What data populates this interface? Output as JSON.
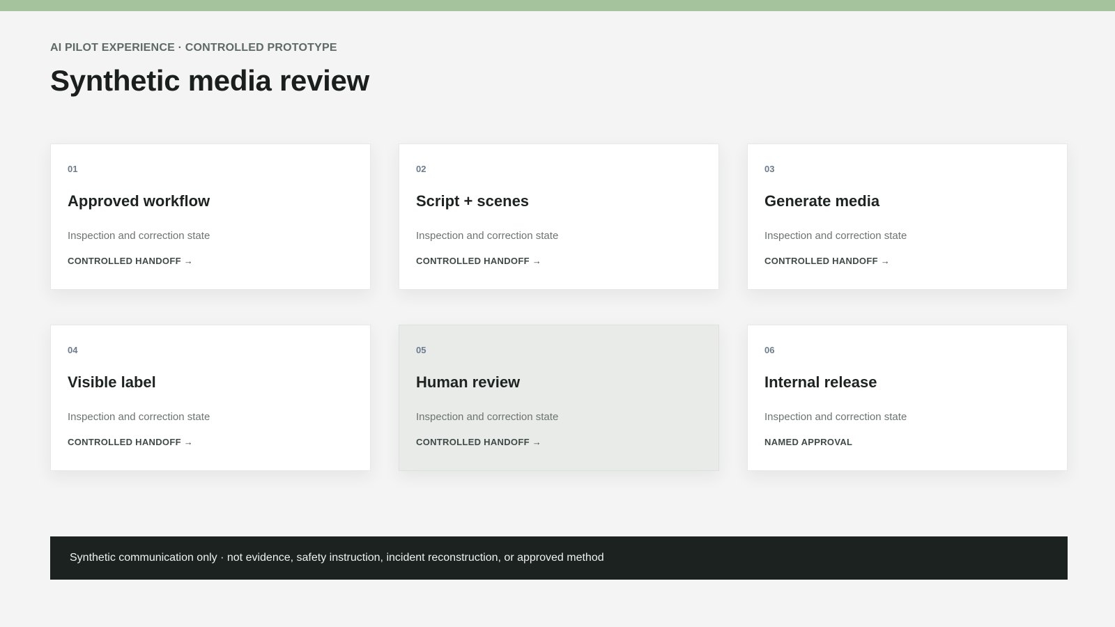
{
  "header": {
    "eyebrow": "AI PILOT EXPERIENCE · CONTROLLED PROTOTYPE",
    "title": "Synthetic media review"
  },
  "cards": [
    {
      "number": "01",
      "title": "Approved workflow",
      "description": "Inspection and correction state",
      "action": "CONTROLLED HANDOFF →"
    },
    {
      "number": "02",
      "title": "Script + scenes",
      "description": "Inspection and correction state",
      "action": "CONTROLLED HANDOFF →"
    },
    {
      "number": "03",
      "title": "Generate media",
      "description": "Inspection and correction state",
      "action": "CONTROLLED HANDOFF →"
    },
    {
      "number": "04",
      "title": "Visible label",
      "description": "Inspection and correction state",
      "action": "CONTROLLED HANDOFF →"
    },
    {
      "number": "05",
      "title": "Human review",
      "description": "Inspection and correction state",
      "action": "CONTROLLED HANDOFF →"
    },
    {
      "number": "06",
      "title": "Internal release",
      "description": "Inspection and correction state",
      "action": "NAMED APPROVAL"
    }
  ],
  "footer": {
    "disclaimer": "Synthetic communication only · not evidence, safety instruction, incident reconstruction, or approved method"
  },
  "colors": {
    "accent_bar": "#a5c49e",
    "background": "#f3f4f3",
    "card": "#ffffff",
    "card_highlighted": "#e8ebe8",
    "footer": "#1b2220"
  }
}
